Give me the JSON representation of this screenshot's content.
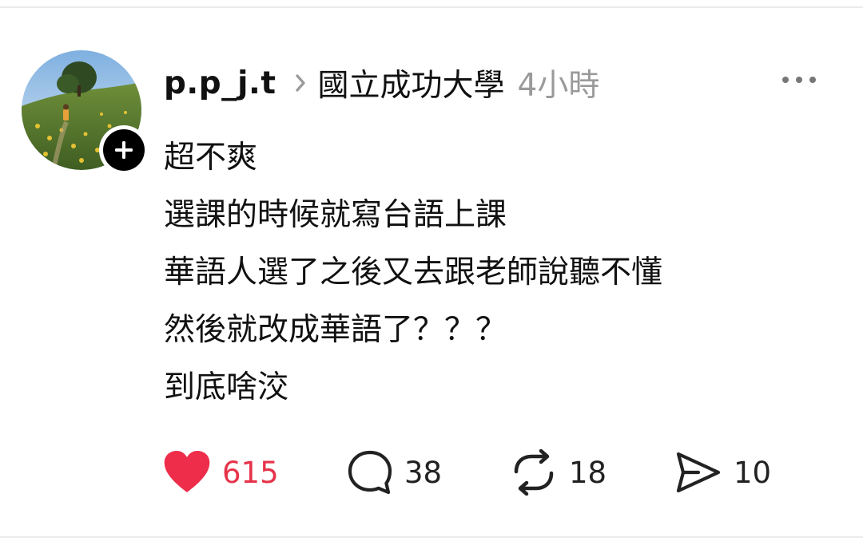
{
  "post": {
    "author": "p.p_j.t",
    "community": "國立成功大學",
    "time_ago": "4小時",
    "lines": [
      "超不爽",
      "選課的時候就寫台語上課",
      "華語人選了之後又去跟老師說聽不懂",
      "然後就改成華語了？？？",
      "到底啥洨"
    ]
  },
  "actions": {
    "like_count": "615",
    "comment_count": "38",
    "repost_count": "18",
    "share_count": "10"
  },
  "icons": {
    "like": "heart-filled-icon",
    "comment": "speech-bubble-icon",
    "repost": "repost-arrows-icon",
    "share": "send-paper-plane-icon",
    "more": "more-horizontal-icon",
    "follow": "plus-icon",
    "separator": "chevron-right-icon"
  },
  "colors": {
    "like_red": "#ee2d4b",
    "muted_gray": "#9a9a9a",
    "text": "#111111"
  }
}
